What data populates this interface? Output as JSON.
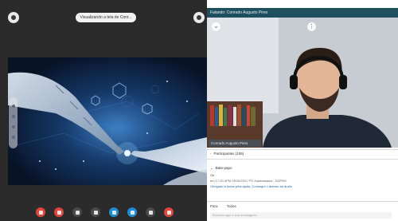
{
  "top": {
    "viewing_label": "Visualizando a tela de Conr...",
    "left_button_icon": "menu-icon",
    "right_button_icon": "options-icon"
  },
  "shared_screen": {
    "description_icon": "robot-hand-touch-image"
  },
  "side_tools": [
    "pointer-tool",
    "pen-tool",
    "eraser-tool",
    "zoom-tool"
  ],
  "controls": [
    {
      "name": "mic-button",
      "color": "#e0463b"
    },
    {
      "name": "video-button",
      "color": "#e0463b"
    },
    {
      "name": "record-button",
      "color": "#4a4a4a"
    },
    {
      "name": "share-button",
      "color": "#4a4a4a"
    },
    {
      "name": "participants-button",
      "color": "#1e8fd6"
    },
    {
      "name": "chat-button",
      "color": "#1e8fd6"
    },
    {
      "name": "more-button",
      "color": "#4a4a4a"
    },
    {
      "name": "leave-button",
      "color": "#e0463b"
    }
  ],
  "panel": {
    "speaker_label": "Falando: Conrado Augusto Pires",
    "name_tag": "Conrado Augusto Pires",
    "participants_section": "Participantes (106)",
    "chat_section": "Bate-papo",
    "chat_ok": "Ok",
    "chat_meta": "em 17:00 APM 09/26/2021 PG Aaaaaaaaaa - SAPRM",
    "chat_message": "Obrigado a todos pela ajuda. Consegui o acesso ao áudio",
    "tab_all": "Para",
    "tab_everyone": "Todos",
    "chat_input_placeholder": "Escreva aqui a sua mensagem..."
  },
  "colors": {
    "speaker_bar": "#1f4e5f",
    "screen_bg": "#0b1d3a",
    "accent_blue": "#1e8fd6",
    "danger_red": "#e0463b"
  }
}
